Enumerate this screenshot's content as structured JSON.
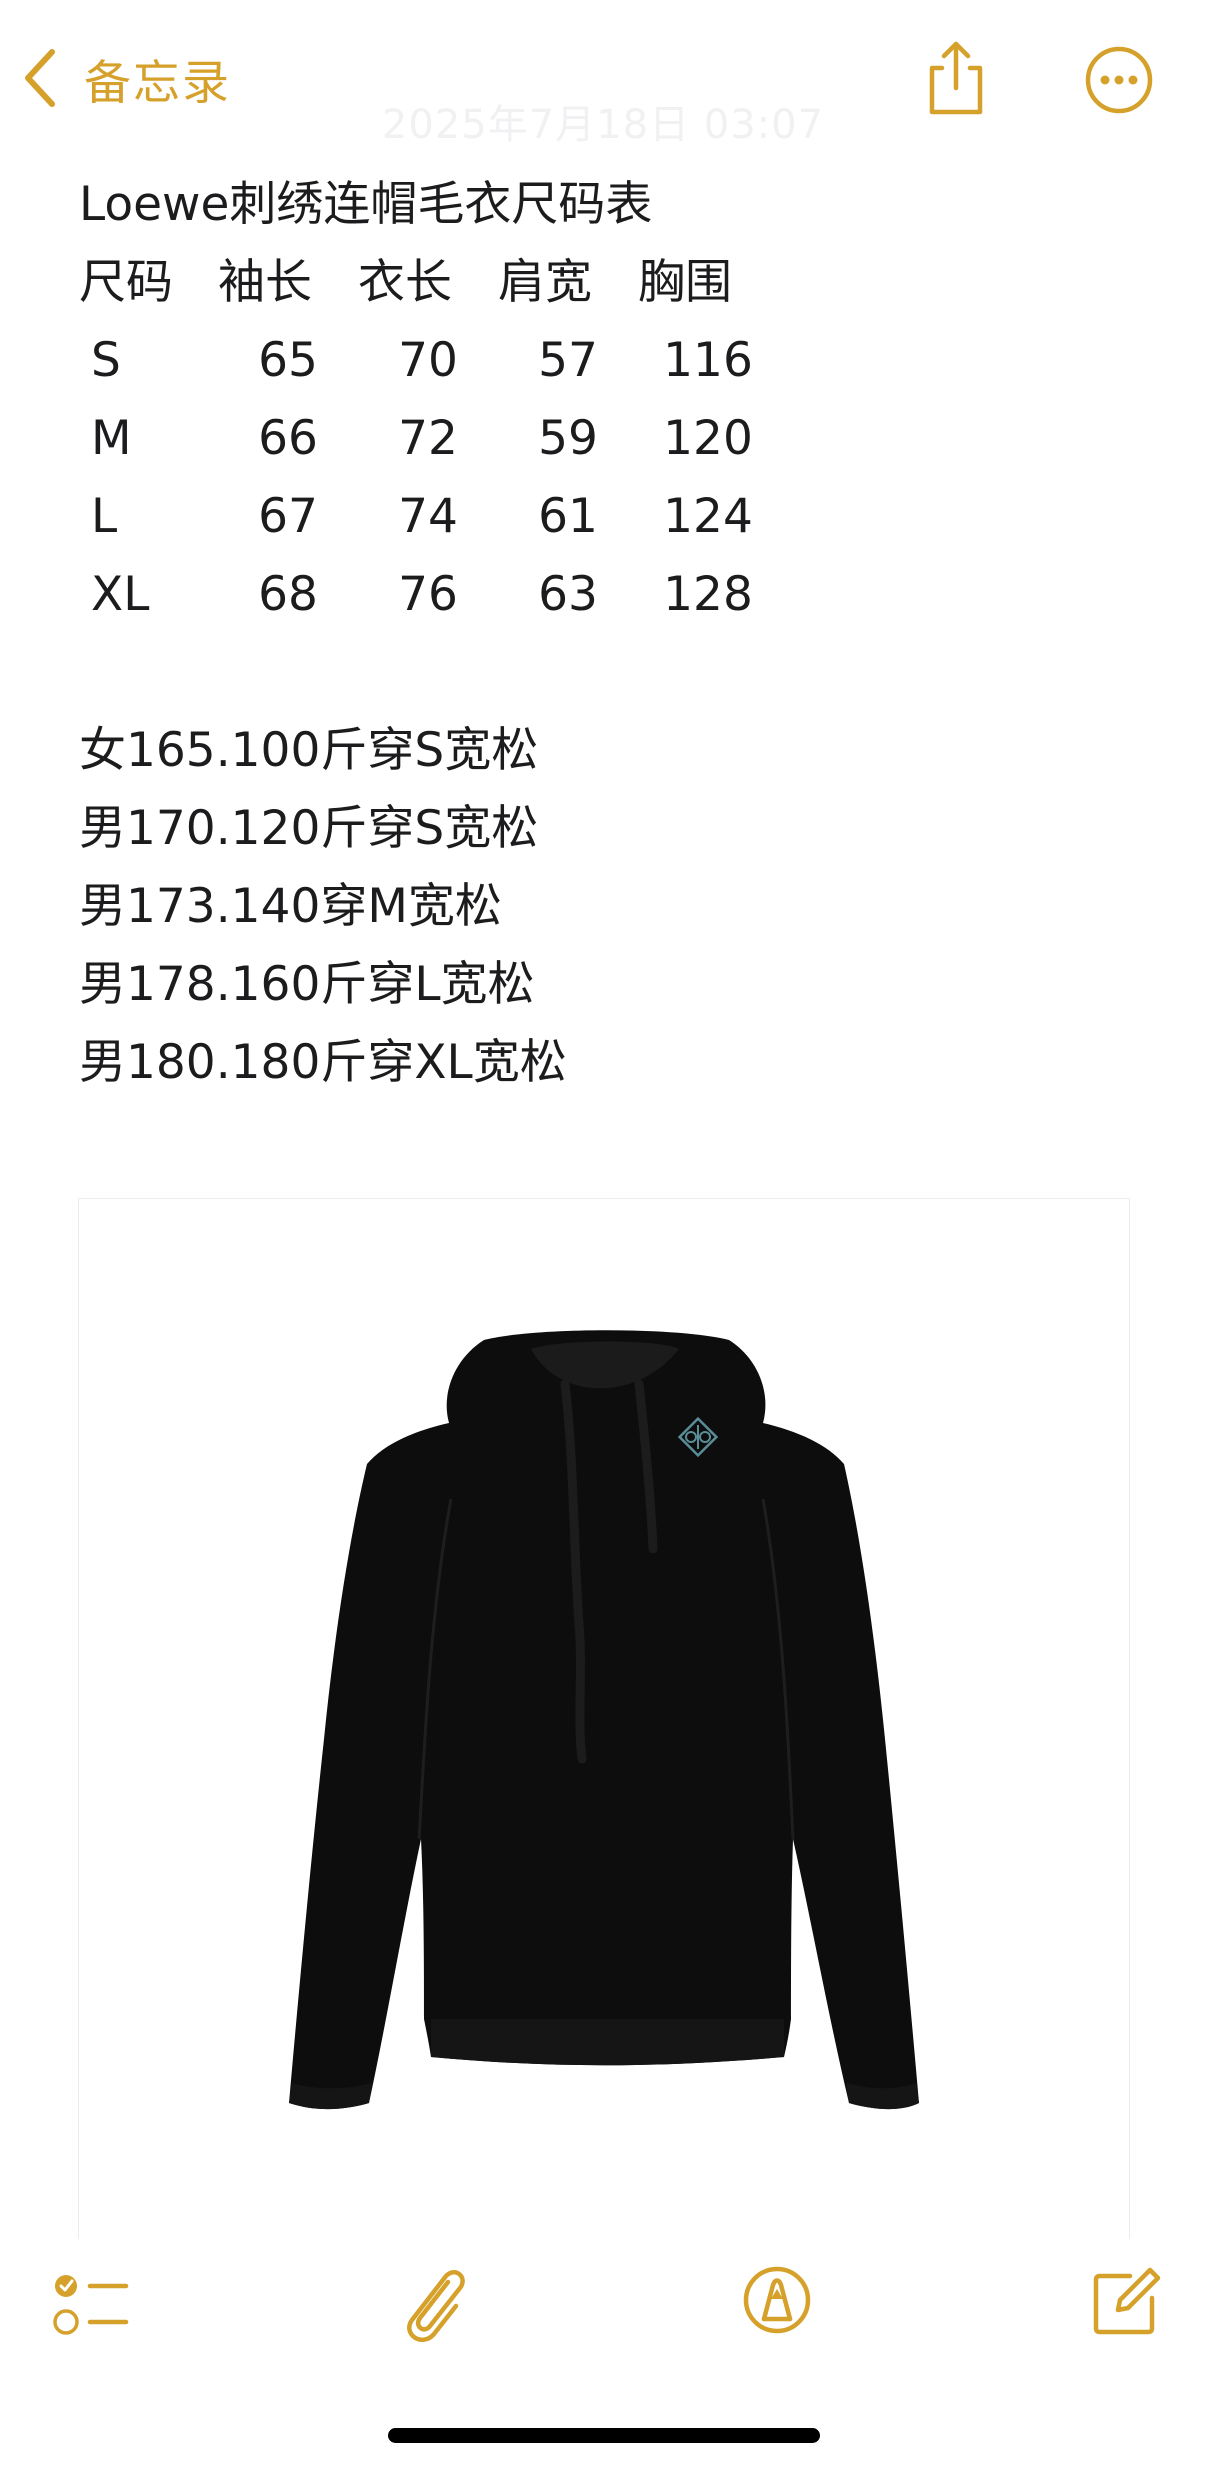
{
  "theme": {
    "accent_color": "#D6A12B",
    "text_color": "#1c1c1e"
  },
  "nav": {
    "back_label": "备忘录",
    "back_icon": "chevron-left-icon",
    "share_icon": "share-icon",
    "more_icon": "more-icon",
    "date_time": "2025年7月18日 03:07"
  },
  "note": {
    "title": "Loewe刺绣连帽毛衣尺码表",
    "table": {
      "headers": [
        "尺码",
        "袖长",
        "衣长",
        "肩宽",
        "胸围"
      ],
      "rows": [
        [
          "S",
          "65",
          "70",
          "57",
          "116"
        ],
        [
          "M",
          "66",
          "72",
          "59",
          "120"
        ],
        [
          "L",
          "67",
          "74",
          "61",
          "124"
        ],
        [
          "XL",
          "68",
          "76",
          "63",
          "128"
        ]
      ]
    },
    "recommendations": [
      "女165.100斤穿S宽松",
      "男170.120斤穿S宽松",
      "男173.140穿M宽松",
      "男178.160斤穿L宽松",
      "男180.180斤穿XL宽松"
    ]
  },
  "attachment": {
    "image_subject": "black knitted hoodie with embroidered anagram logo",
    "logo_color": "#5a8e96"
  },
  "toolbar": {
    "items": [
      "checklist-icon",
      "attachment-icon",
      "markup-icon",
      "compose-icon"
    ]
  }
}
